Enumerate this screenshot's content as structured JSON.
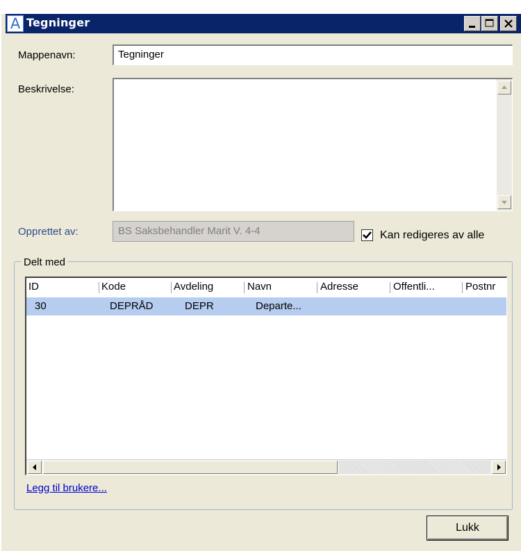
{
  "window": {
    "title": "Tegninger",
    "app_icon_letter": "A",
    "controls": {
      "minimize": "▁",
      "maximize": "□",
      "close": "✕"
    }
  },
  "form": {
    "folder_name_label": "Mappenavn:",
    "folder_name_value": "Tegninger",
    "description_label": "Beskrivelse:",
    "description_value": "",
    "created_by_label": "Opprettet av:",
    "created_by_value": "BS Saksbehandler Marit V.  4-4",
    "editable_by_all_label": "Kan redigeres av alle",
    "editable_by_all_checked": true
  },
  "shared_with": {
    "group_label": "Delt med",
    "columns": [
      "ID",
      "Kode",
      "Avdeling",
      "Navn",
      "Adresse",
      "Offentli...",
      "Postnr"
    ],
    "rows": [
      {
        "id": "30",
        "kode": "DEPRÅD",
        "avdeling": "DEPR",
        "navn": "Departe...",
        "adresse": "",
        "offentlig": "",
        "postnr": ""
      }
    ],
    "add_users_link": "Legg til brukere..."
  },
  "footer": {
    "close_button": "Lukk"
  },
  "colors": {
    "titlebar": "#0a246a",
    "selected_row": "#b6cdf0",
    "dialog_bg": "#ece9d8",
    "link": "#0000cc"
  }
}
